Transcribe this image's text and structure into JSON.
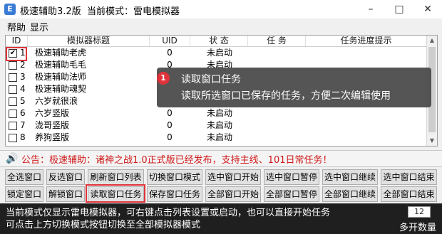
{
  "window": {
    "title": "极速辅助3.2版  当前模式：雷电模拟器",
    "icon": "app-icon-letter",
    "icon_glyph": "E"
  },
  "menu": {
    "items": [
      "帮助",
      "显示"
    ]
  },
  "table": {
    "headers": {
      "id": "ID",
      "title": "模拟器标题",
      "uid": "UID",
      "status": "状 态",
      "task": "任 务",
      "progress": "任务进度提示"
    },
    "rows": [
      {
        "id": "1",
        "checked": true,
        "title": "极速辅助老虎",
        "uid": "0",
        "status": "未启动"
      },
      {
        "id": "2",
        "checked": false,
        "title": "极速辅助毛毛",
        "uid": "0",
        "status": "未启动"
      },
      {
        "id": "3",
        "checked": false,
        "title": "极速辅助法师",
        "uid": "",
        "status": ""
      },
      {
        "id": "4",
        "checked": false,
        "title": "极速辅助魂契",
        "uid": "",
        "status": ""
      },
      {
        "id": "5",
        "checked": false,
        "title": "六岁就很浪",
        "uid": "",
        "status": ""
      },
      {
        "id": "6",
        "checked": false,
        "title": "六岁竖版",
        "uid": "0",
        "status": "未启动"
      },
      {
        "id": "7",
        "checked": false,
        "title": "泷哥竖版",
        "uid": "0",
        "status": "未启动"
      },
      {
        "id": "8",
        "checked": false,
        "title": "养狗竖版",
        "uid": "0",
        "status": "未启动"
      }
    ]
  },
  "tooltip": {
    "badge": "1",
    "title": "读取窗口任务",
    "description": "读取所选窗口已保存的任务，方便二次编辑使用"
  },
  "notice": {
    "text": "公告：极速辅助：诸神之战1.0正式版已经发布，支持主线、101日常任务！"
  },
  "buttons": {
    "row1": [
      "全选窗口",
      "反选窗口",
      "刷新窗口列表",
      "切换窗口模式",
      "选中窗口开始",
      "选中窗口暂停",
      "选中窗口继续",
      "选中窗口结束"
    ],
    "row2": [
      "锁定窗口",
      "解锁窗口",
      "读取窗口任务",
      "保存窗口任务",
      "全部窗口开始",
      "全部窗口暂停",
      "全部窗口继续",
      "全部窗口结束"
    ]
  },
  "status": {
    "line1": "当前模式仅显示雷电模拟器，可右键点击列表设置或启动，也可以直接开始任务",
    "line2": "可点击上方切换模式按钮切换至全部模拟器模式",
    "count": "12",
    "open_label": "多开数量"
  },
  "colors": {
    "highlight": "#e0323a",
    "notice_text": "#d01a1a",
    "status_bg": "#1f1f1f"
  }
}
